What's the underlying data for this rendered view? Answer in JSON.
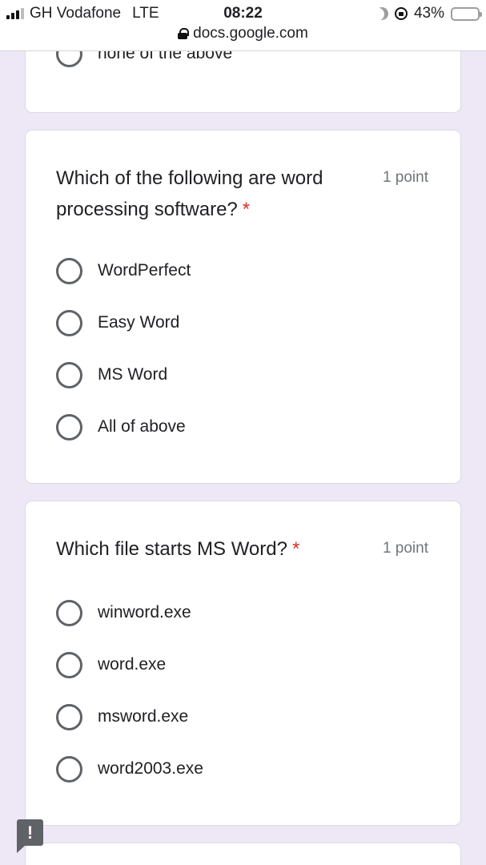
{
  "status_bar": {
    "carrier": "GH Vodafone",
    "network": "LTE",
    "time": "08:22",
    "battery_percent": "43%",
    "battery_level": 0.43,
    "url": "docs.google.com"
  },
  "previous_question": {
    "last_option": "none of the above"
  },
  "questions": [
    {
      "title": "Which of the following are word processing software?",
      "required_marker": "*",
      "points": "1 point",
      "options": [
        "WordPerfect",
        "Easy Word",
        "MS Word",
        "All of above"
      ]
    },
    {
      "title": "Which file starts MS Word?",
      "required_marker": "*",
      "points": "1 point",
      "options": [
        "winword.exe",
        "word.exe",
        "msword.exe",
        "word2003.exe"
      ]
    }
  ],
  "feedback_button": {
    "label": "!"
  },
  "colors": {
    "page_background": "#ede7f6",
    "required": "#d93025",
    "radio_border": "#5f6368",
    "battery": "#f6c700"
  }
}
